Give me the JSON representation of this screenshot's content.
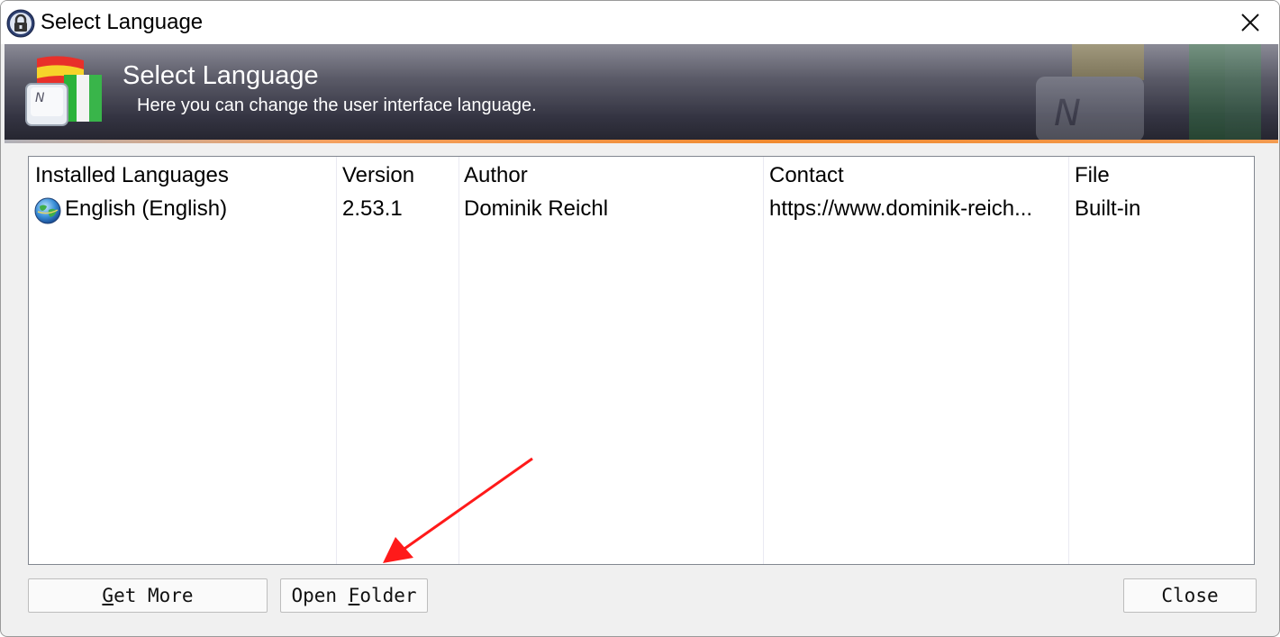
{
  "window": {
    "title": "Select Language"
  },
  "banner": {
    "title": "Select Language",
    "subtitle": "Here you can change the user interface language."
  },
  "list": {
    "columns": [
      "Installed Languages",
      "Version",
      "Author",
      "Contact",
      "File"
    ],
    "rows": [
      {
        "language": "English (English)",
        "version": "2.53.1",
        "author": "Dominik Reichl",
        "contact": "https://www.dominik-reich...",
        "file": "Built-in"
      }
    ]
  },
  "buttons": {
    "get_more": {
      "pre": "",
      "key": "G",
      "post": "et More"
    },
    "open_folder": {
      "pre": "Open ",
      "key": "F",
      "post": "older"
    },
    "close": "Close"
  },
  "colors": {
    "banner_dark": "#25252f",
    "banner_accent": "#f08a30",
    "annotation_arrow": "#ff1a1a"
  }
}
